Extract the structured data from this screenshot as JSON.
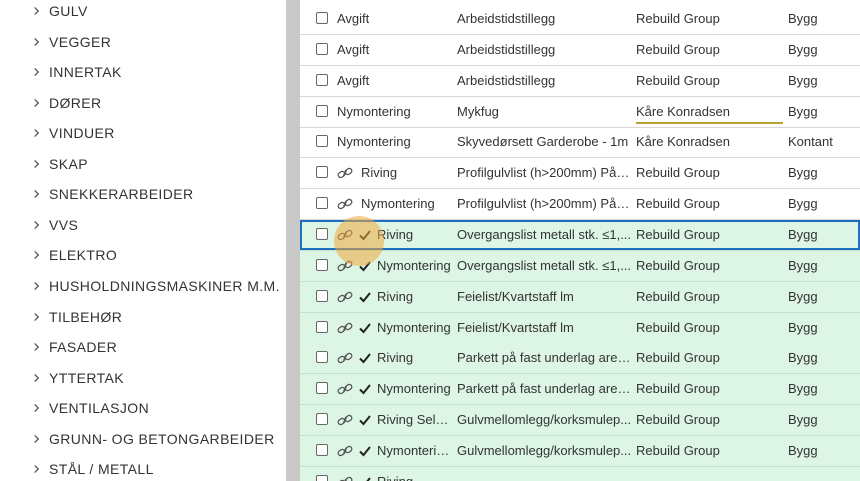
{
  "sidebar": {
    "items": [
      {
        "label": "GULV"
      },
      {
        "label": "VEGGER"
      },
      {
        "label": "INNERTAK"
      },
      {
        "label": "DØRER"
      },
      {
        "label": "VINDUER"
      },
      {
        "label": "SKAP"
      },
      {
        "label": "SNEKKERARBEIDER"
      },
      {
        "label": "VVS"
      },
      {
        "label": "ELEKTRO"
      },
      {
        "label": "HUSHOLDNINGSMASKINER M.M."
      },
      {
        "label": "TILBEHØR"
      },
      {
        "label": "FASADER"
      },
      {
        "label": "YTTERTAK"
      },
      {
        "label": "VENTILASJON"
      },
      {
        "label": "GRUNN- OG BETONGARBEIDER"
      },
      {
        "label": "STÅL / METALL"
      }
    ]
  },
  "table": {
    "rows": [
      {
        "type": "Avgift",
        "description": "Arbeidstidstillegg",
        "group": "Rebuild Group",
        "category": "Bygg",
        "linked": false,
        "done": false
      },
      {
        "type": "Avgift",
        "description": "Arbeidstidstillegg",
        "group": "Rebuild Group",
        "category": "Bygg",
        "linked": false,
        "done": false
      },
      {
        "type": "Avgift",
        "description": "Arbeidstidstillegg",
        "group": "Rebuild Group",
        "category": "Bygg",
        "linked": false,
        "done": false
      },
      {
        "type": "Nymontering",
        "description": "Mykfug",
        "group": "Kåre Konradsen",
        "category": "Bygg",
        "linked": false,
        "done": false,
        "underlined": true
      },
      {
        "type": "Nymontering",
        "description": "Skyvedørsett Garderobe - 1m",
        "group": "Kåre Konradsen",
        "category": "Kontant",
        "linked": false,
        "done": false
      },
      {
        "type": "Riving",
        "description": "Profilgulvlist (h>200mm) På t...",
        "group": "Rebuild Group",
        "category": "Bygg",
        "linked": true,
        "done": false
      },
      {
        "type": "Nymontering",
        "description": "Profilgulvlist (h>200mm) På t...",
        "group": "Rebuild Group",
        "category": "Bygg",
        "linked": true,
        "done": false
      },
      {
        "type": "Riving",
        "description": "Overgangslist metall stk. ≤1,...",
        "group": "Rebuild Group",
        "category": "Bygg",
        "linked": true,
        "done": true,
        "selected": true
      },
      {
        "type": "Nymontering",
        "description": "Overgangslist metall stk. ≤1,...",
        "group": "Rebuild Group",
        "category": "Bygg",
        "linked": true,
        "done": true
      },
      {
        "type": "Riving",
        "description": "Feielist/Kvartstaff lm",
        "group": "Rebuild Group",
        "category": "Bygg",
        "linked": true,
        "done": true
      },
      {
        "type": "Nymontering",
        "description": "Feielist/Kvartstaff lm",
        "group": "Rebuild Group",
        "category": "Bygg",
        "linked": true,
        "done": true
      },
      {
        "type": "Riving",
        "description": "Parkett på fast underlag area...",
        "group": "Rebuild Group",
        "category": "Bygg",
        "linked": true,
        "done": true
      },
      {
        "type": "Nymontering",
        "description": "Parkett på fast underlag area...",
        "group": "Rebuild Group",
        "category": "Bygg",
        "linked": true,
        "done": true
      },
      {
        "type": "Riving Selvk...",
        "description": "Gulvmellomlegg/korksmulep...",
        "group": "Rebuild Group",
        "category": "Bygg",
        "linked": true,
        "done": true
      },
      {
        "type": "Nymonterin...",
        "description": "Gulvmellomlegg/korksmulep...",
        "group": "Rebuild Group",
        "category": "Bygg",
        "linked": true,
        "done": true
      },
      {
        "type": "Riving",
        "description": "",
        "group": "",
        "category": "",
        "linked": true,
        "done": true
      }
    ]
  }
}
